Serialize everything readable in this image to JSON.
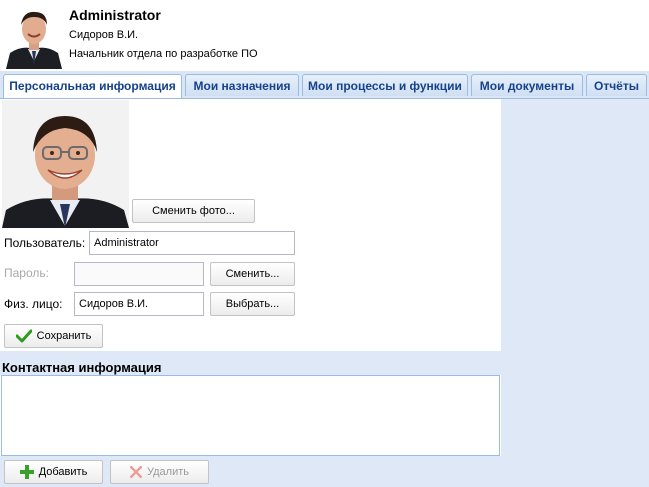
{
  "header": {
    "user_name": "Administrator",
    "user_short_name": "Сидоров В.И.",
    "user_position": "Начальник отдела по разработке ПО"
  },
  "tabs": [
    {
      "label": "Персональная информация",
      "active": true
    },
    {
      "label": "Мои назначения",
      "active": false
    },
    {
      "label": "Мои процессы и функции",
      "active": false
    },
    {
      "label": "Мои документы",
      "active": false
    },
    {
      "label": "Отчёты",
      "active": false
    }
  ],
  "personal": {
    "change_photo_label": "Сменить фото...",
    "user_label": "Пользователь:",
    "user_value": "Administrator",
    "password_label": "Пароль:",
    "password_value": "",
    "change_password_label": "Сменить...",
    "person_label": "Физ. лицо:",
    "person_value": "Сидоров В.И.",
    "select_person_label": "Выбрать...",
    "save_label": "Сохранить"
  },
  "contacts": {
    "title": "Контактная информация",
    "add_label": "Добавить",
    "delete_label": "Удалить"
  },
  "colors": {
    "tab_text": "#15428b",
    "panel_bg": "#dfe8f6",
    "border_blue": "#99bbe8",
    "save_icon": "#2e9b1f",
    "add_icon": "#3aa02c",
    "delete_icon_disabled": "#e7a0a0"
  }
}
